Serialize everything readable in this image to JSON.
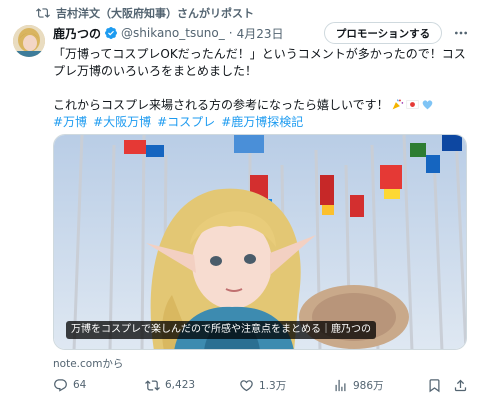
{
  "repost": {
    "text": "吉村洋文（大阪府知事）さんがリポスト",
    "icon": "repost-icon"
  },
  "author": {
    "name": "鹿乃つの",
    "handle": "@shikano_tsuno_",
    "separator": "·",
    "date": "4月23日",
    "verified_color": "#1d9bf0"
  },
  "promote_label": "プロモーションする",
  "tweet": {
    "line1": "「万博ってコスプレOKだったんだ！」というコメントが多かったので！コス",
    "line2": "プレ万博のいろいろをまとめました！",
    "line3": "これからコスプレ来場される方の参考になったら嬉しいです！",
    "hashtags": [
      "#万博",
      "#大阪万博",
      "#コスプレ",
      "#鹿万博探検記"
    ]
  },
  "card": {
    "caption": "万博をコスプレで楽しんだので所感や注意点をまとめる｜鹿乃つの"
  },
  "source": "note.comから",
  "actions": {
    "reply": "64",
    "repost": "6,423",
    "like": "1.3万",
    "views": "986万"
  },
  "colors": {
    "link": "#1d9bf0",
    "muted": "#536471",
    "text": "#0f1419"
  }
}
